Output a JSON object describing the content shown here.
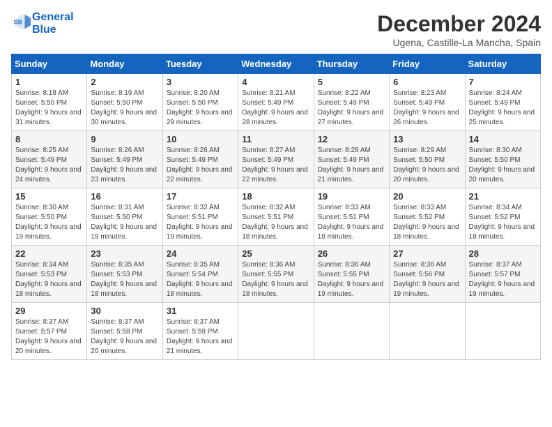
{
  "logo": {
    "line1": "General",
    "line2": "Blue"
  },
  "title": "December 2024",
  "subtitle": "Ugena, Castille-La Mancha, Spain",
  "weekdays": [
    "Sunday",
    "Monday",
    "Tuesday",
    "Wednesday",
    "Thursday",
    "Friday",
    "Saturday"
  ],
  "weeks": [
    [
      {
        "day": "1",
        "sunrise": "8:18 AM",
        "sunset": "5:50 PM",
        "daylight": "9 hours and 31 minutes."
      },
      {
        "day": "2",
        "sunrise": "8:19 AM",
        "sunset": "5:50 PM",
        "daylight": "9 hours and 30 minutes."
      },
      {
        "day": "3",
        "sunrise": "8:20 AM",
        "sunset": "5:50 PM",
        "daylight": "9 hours and 29 minutes."
      },
      {
        "day": "4",
        "sunrise": "8:21 AM",
        "sunset": "5:49 PM",
        "daylight": "9 hours and 28 minutes."
      },
      {
        "day": "5",
        "sunrise": "8:22 AM",
        "sunset": "5:49 PM",
        "daylight": "9 hours and 27 minutes."
      },
      {
        "day": "6",
        "sunrise": "8:23 AM",
        "sunset": "5:49 PM",
        "daylight": "9 hours and 26 minutes."
      },
      {
        "day": "7",
        "sunrise": "8:24 AM",
        "sunset": "5:49 PM",
        "daylight": "9 hours and 25 minutes."
      }
    ],
    [
      {
        "day": "8",
        "sunrise": "8:25 AM",
        "sunset": "5:49 PM",
        "daylight": "9 hours and 24 minutes."
      },
      {
        "day": "9",
        "sunrise": "8:26 AM",
        "sunset": "5:49 PM",
        "daylight": "9 hours and 23 minutes."
      },
      {
        "day": "10",
        "sunrise": "8:26 AM",
        "sunset": "5:49 PM",
        "daylight": "9 hours and 22 minutes."
      },
      {
        "day": "11",
        "sunrise": "8:27 AM",
        "sunset": "5:49 PM",
        "daylight": "9 hours and 22 minutes."
      },
      {
        "day": "12",
        "sunrise": "8:28 AM",
        "sunset": "5:49 PM",
        "daylight": "9 hours and 21 minutes."
      },
      {
        "day": "13",
        "sunrise": "8:29 AM",
        "sunset": "5:50 PM",
        "daylight": "9 hours and 20 minutes."
      },
      {
        "day": "14",
        "sunrise": "8:30 AM",
        "sunset": "5:50 PM",
        "daylight": "9 hours and 20 minutes."
      }
    ],
    [
      {
        "day": "15",
        "sunrise": "8:30 AM",
        "sunset": "5:50 PM",
        "daylight": "9 hours and 19 minutes."
      },
      {
        "day": "16",
        "sunrise": "8:31 AM",
        "sunset": "5:50 PM",
        "daylight": "9 hours and 19 minutes."
      },
      {
        "day": "17",
        "sunrise": "8:32 AM",
        "sunset": "5:51 PM",
        "daylight": "9 hours and 19 minutes."
      },
      {
        "day": "18",
        "sunrise": "8:32 AM",
        "sunset": "5:51 PM",
        "daylight": "9 hours and 18 minutes."
      },
      {
        "day": "19",
        "sunrise": "8:33 AM",
        "sunset": "5:51 PM",
        "daylight": "9 hours and 18 minutes."
      },
      {
        "day": "20",
        "sunrise": "8:33 AM",
        "sunset": "5:52 PM",
        "daylight": "9 hours and 18 minutes."
      },
      {
        "day": "21",
        "sunrise": "8:34 AM",
        "sunset": "5:52 PM",
        "daylight": "9 hours and 18 minutes."
      }
    ],
    [
      {
        "day": "22",
        "sunrise": "8:34 AM",
        "sunset": "5:53 PM",
        "daylight": "9 hours and 18 minutes."
      },
      {
        "day": "23",
        "sunrise": "8:35 AM",
        "sunset": "5:53 PM",
        "daylight": "9 hours and 18 minutes."
      },
      {
        "day": "24",
        "sunrise": "8:35 AM",
        "sunset": "5:54 PM",
        "daylight": "9 hours and 18 minutes."
      },
      {
        "day": "25",
        "sunrise": "8:36 AM",
        "sunset": "5:55 PM",
        "daylight": "9 hours and 18 minutes."
      },
      {
        "day": "26",
        "sunrise": "8:36 AM",
        "sunset": "5:55 PM",
        "daylight": "9 hours and 19 minutes."
      },
      {
        "day": "27",
        "sunrise": "8:36 AM",
        "sunset": "5:56 PM",
        "daylight": "9 hours and 19 minutes."
      },
      {
        "day": "28",
        "sunrise": "8:37 AM",
        "sunset": "5:57 PM",
        "daylight": "9 hours and 19 minutes."
      }
    ],
    [
      {
        "day": "29",
        "sunrise": "8:37 AM",
        "sunset": "5:57 PM",
        "daylight": "9 hours and 20 minutes."
      },
      {
        "day": "30",
        "sunrise": "8:37 AM",
        "sunset": "5:58 PM",
        "daylight": "9 hours and 20 minutes."
      },
      {
        "day": "31",
        "sunrise": "8:37 AM",
        "sunset": "5:59 PM",
        "daylight": "9 hours and 21 minutes."
      },
      null,
      null,
      null,
      null
    ]
  ]
}
